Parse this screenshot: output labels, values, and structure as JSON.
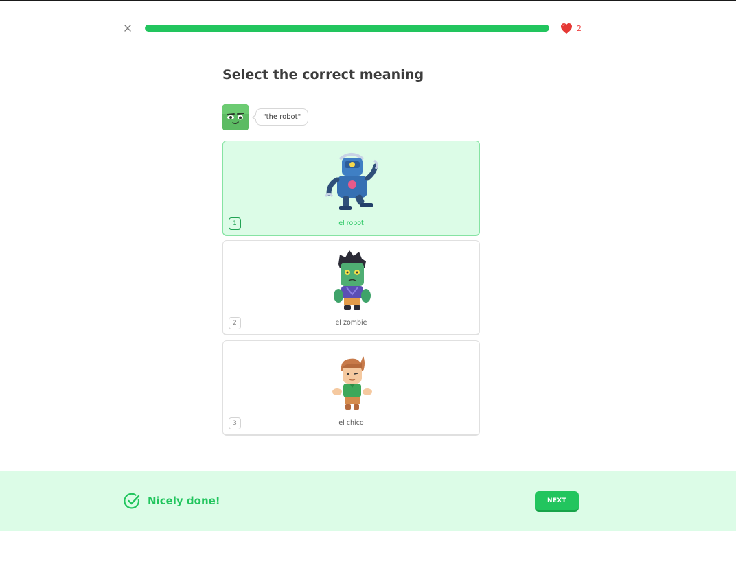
{
  "header": {
    "close_icon": "close-icon",
    "progress_fraction": 1.0,
    "progress_color": "#22c55e",
    "hearts_icon": "heart-icon",
    "hearts_count": "2"
  },
  "prompt": {
    "title": "Select the correct meaning",
    "speaker_icon": "character-avatar",
    "bubble_text": "\"the robot\""
  },
  "options": [
    {
      "number": "1",
      "label": "el robot",
      "image": "robot-illustration",
      "selected": true
    },
    {
      "number": "2",
      "label": "el zombie",
      "image": "zombie-illustration",
      "selected": false
    },
    {
      "number": "3",
      "label": "el chico",
      "image": "boy-illustration",
      "selected": false
    }
  ],
  "footer": {
    "check_icon": "check-circle-icon",
    "message": "Nicely done!",
    "next_label": "NEXT",
    "background_color": "#dcfce7",
    "accent_color": "#22c55e"
  }
}
